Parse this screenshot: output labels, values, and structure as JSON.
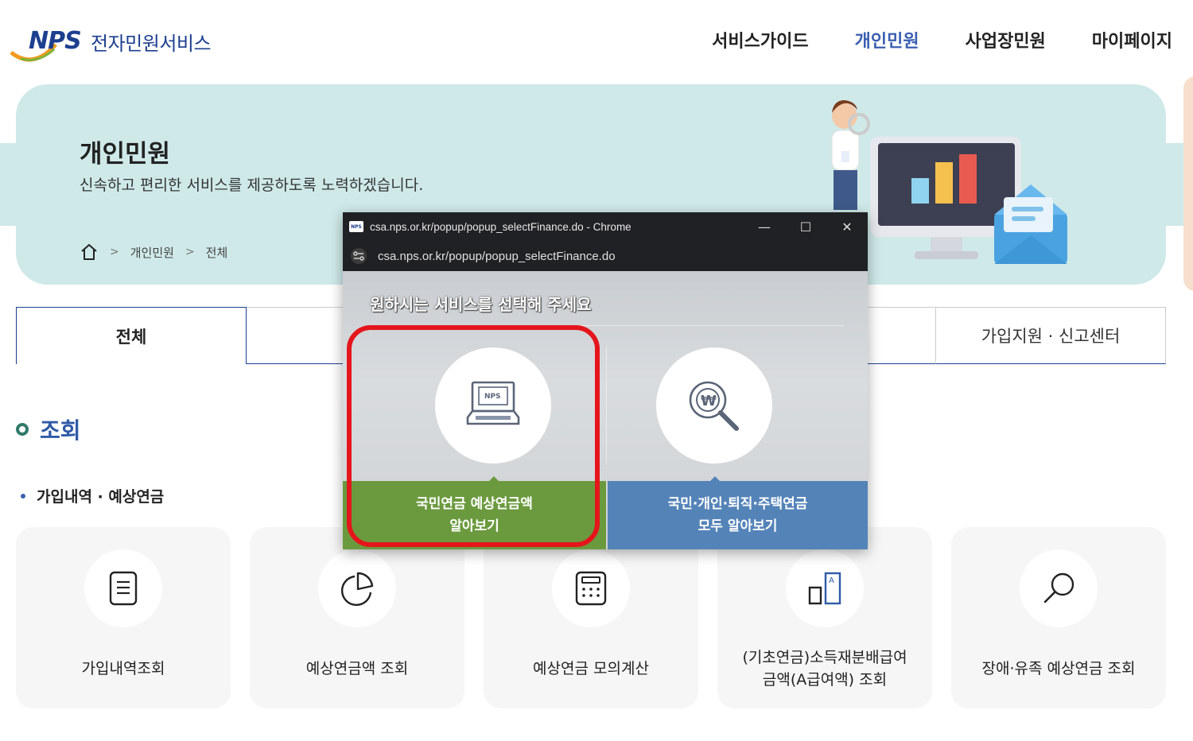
{
  "header": {
    "logo_text": "NPS",
    "site_title": "전자민원서비스",
    "nav": [
      {
        "label": "서비스가이드",
        "active": false
      },
      {
        "label": "개인민원",
        "active": true
      },
      {
        "label": "사업장민원",
        "active": false
      },
      {
        "label": "마이페이지",
        "active": false
      }
    ]
  },
  "banner": {
    "title": "개인민원",
    "subtitle": "신속하고 편리한 서비스를 제공하도록 노력하겠습니다.",
    "breadcrumb": [
      "개인민원",
      "전체"
    ]
  },
  "tabs": {
    "first": "전체",
    "last": "가입지원 · 신고센터"
  },
  "section": {
    "title": "조회",
    "subtitle": "가입내역 · 예상연금"
  },
  "cards": [
    {
      "icon": "document-icon",
      "label": "가입내역조회"
    },
    {
      "icon": "pie-chart-icon",
      "label": "예상연금액 조회"
    },
    {
      "icon": "calculator-icon",
      "label": "예상연금 모의계산"
    },
    {
      "icon": "benefit-compare-icon",
      "label_line1": "(기초연금)소득재분배급여",
      "label_line2": "금액(A급여액) 조회"
    },
    {
      "icon": "magnifier-icon",
      "label": "장애·유족 예상연금 조회"
    }
  ],
  "popup": {
    "window_title": "csa.nps.or.kr/popup/popup_selectFinance.do - Chrome",
    "url": "csa.nps.or.kr/popup/popup_selectFinance.do",
    "heading": "원하시는 서비스를 선택해 주세요",
    "option1_line1": "국민연금 예상연금액",
    "option1_line2": "알아보기",
    "option2_line1": "국민·개인·퇴직·주택연금",
    "option2_line2": "모두 알아보기",
    "laptop_logo": "NPS",
    "win_minimize": "—",
    "win_maximize": "☐",
    "win_close": "✕"
  },
  "colors": {
    "brand_blue": "#1c3f8f",
    "banner_bg": "#cfe9e9",
    "option1": "#6b9a3e",
    "option2": "#5483b8",
    "highlight": "#e4161c"
  }
}
